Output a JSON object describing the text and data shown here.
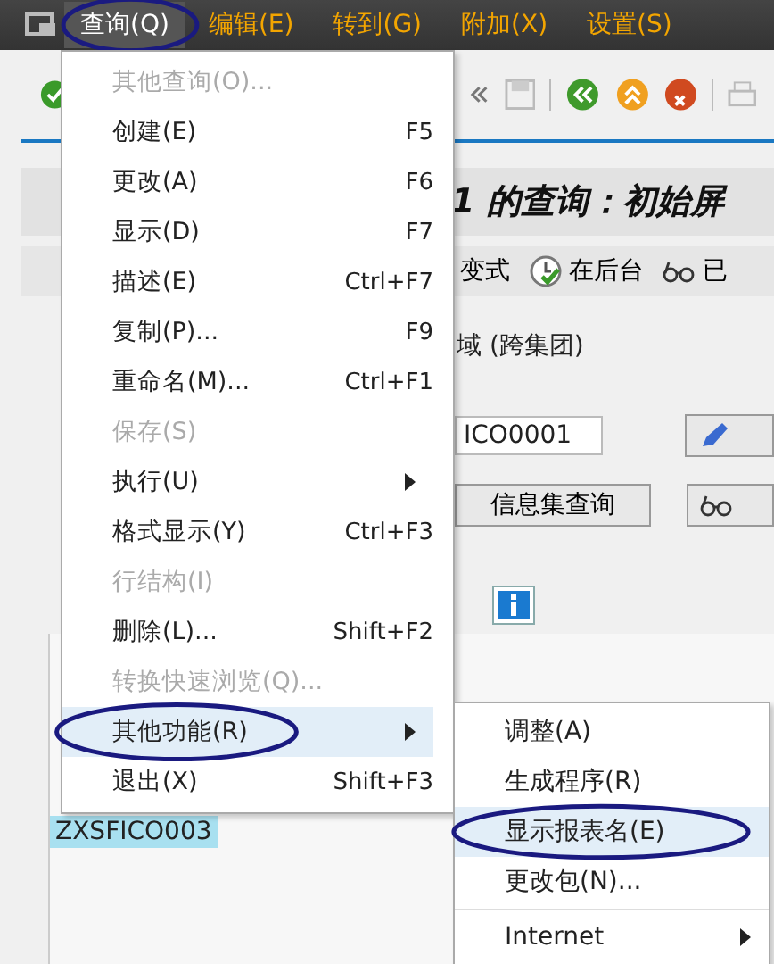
{
  "menu_bar": [
    {
      "label": "查询(Q)",
      "selected": true,
      "circled": true
    },
    {
      "label": "编辑(E)",
      "selected": false,
      "circled": false
    },
    {
      "label": "转到(G)",
      "selected": false,
      "circled": false
    },
    {
      "label": "附加(X)",
      "selected": false,
      "circled": false
    },
    {
      "label": "设置(S)",
      "selected": false,
      "circled": false
    }
  ],
  "title": "1 的查询：初始屏",
  "app_toolbar": [
    {
      "label": "变式"
    },
    {
      "label": "在后台"
    },
    {
      "label": "已"
    }
  ],
  "form": {
    "scope_text": "域 (跨集团)",
    "query_field": {
      "value": "ICO0001"
    },
    "infoset_button": "信息集查询"
  },
  "table": {
    "rows": [
      {
        "cells": [
          "ZXSFICO003"
        ]
      }
    ]
  },
  "menu": [
    {
      "kind": "item",
      "label": "其他查询(O)...",
      "disabled": true,
      "selected": false,
      "circled": false
    },
    {
      "kind": "item",
      "label": "创建(E)",
      "shortcut": "F5",
      "disabled": false,
      "selected": false,
      "circled": false
    },
    {
      "kind": "item",
      "label": "更改(A)",
      "shortcut": "F6",
      "disabled": false,
      "selected": false,
      "circled": false
    },
    {
      "kind": "item",
      "label": "显示(D)",
      "shortcut": "F7",
      "disabled": false,
      "selected": false,
      "circled": false
    },
    {
      "kind": "item",
      "label": "描述(E)",
      "shortcut": "Ctrl+F7",
      "disabled": false,
      "selected": false,
      "circled": false
    },
    {
      "kind": "item",
      "label": "复制(P)...",
      "shortcut": "F9",
      "disabled": false,
      "selected": false,
      "circled": false
    },
    {
      "kind": "item",
      "label": "重命名(M)...",
      "shortcut": "Ctrl+F1",
      "disabled": false,
      "selected": false,
      "circled": false
    },
    {
      "kind": "item",
      "label": "保存(S)",
      "disabled": true,
      "selected": false,
      "circled": false
    },
    {
      "kind": "submenu",
      "label": "执行(U)",
      "disabled": false,
      "selected": false,
      "circled": false
    },
    {
      "kind": "item",
      "label": "格式显示(Y)",
      "shortcut": "Ctrl+F3",
      "disabled": false,
      "selected": false,
      "circled": false
    },
    {
      "kind": "item",
      "label": "行结构(I)",
      "disabled": true,
      "selected": false,
      "circled": false
    },
    {
      "kind": "item",
      "label": "删除(L)...",
      "shortcut": "Shift+F2",
      "disabled": false,
      "selected": false,
      "circled": false
    },
    {
      "kind": "item",
      "label": "转换快速浏览(Q)...",
      "disabled": true,
      "selected": false,
      "circled": false
    },
    {
      "kind": "submenu",
      "label": "其他功能(R)",
      "disabled": false,
      "selected": true,
      "circled": true
    },
    {
      "kind": "item",
      "label": "退出(X)",
      "shortcut": "Shift+F3",
      "disabled": false,
      "selected": false,
      "circled": false
    }
  ],
  "submenu": [
    {
      "kind": "item",
      "label": "调整(A)",
      "selected": false,
      "circled": false
    },
    {
      "kind": "item",
      "label": "生成程序(R)",
      "selected": false,
      "circled": false
    },
    {
      "kind": "item",
      "label": "显示报表名(E)",
      "selected": true,
      "circled": true
    },
    {
      "kind": "item",
      "label": "更改包(N)...",
      "selected": false,
      "circled": false
    },
    {
      "kind": "separator"
    },
    {
      "kind": "submenu",
      "label": "Internet",
      "selected": false,
      "circled": false
    }
  ]
}
